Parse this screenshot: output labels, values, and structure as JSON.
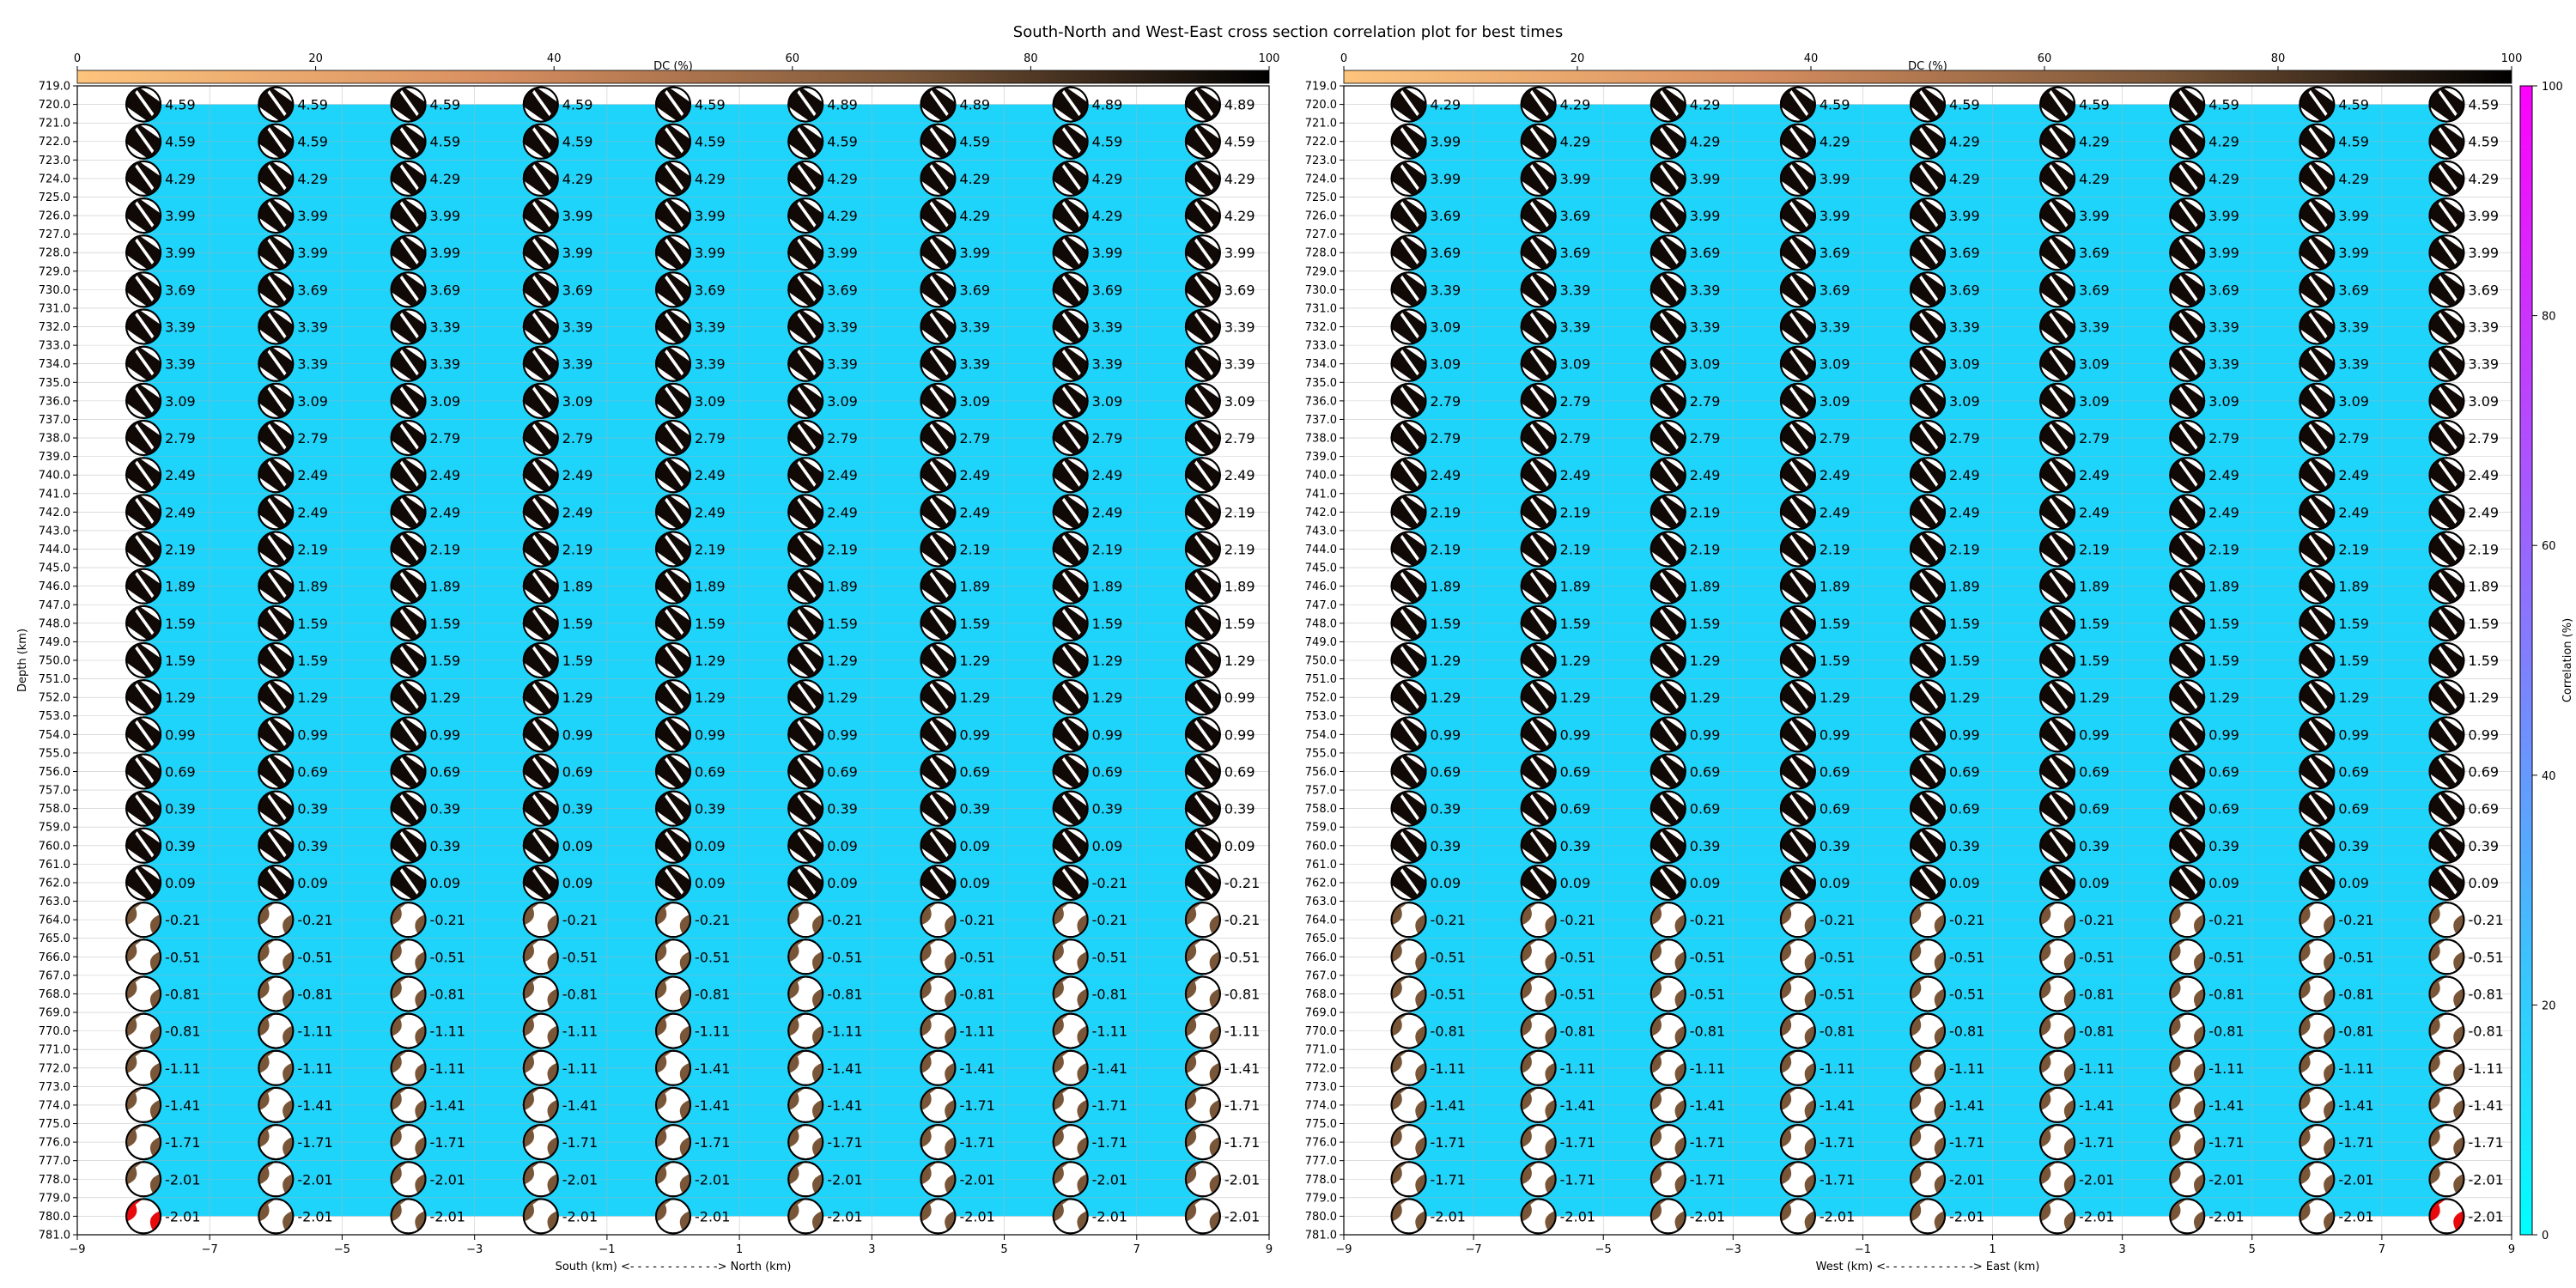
{
  "figure": {
    "title": "South-North and West-East cross section correlation plot for best times",
    "colorbar_correlation_label": "Correlation (%)",
    "colorbar_correlation_ticks": [
      "0",
      "20",
      "40",
      "60",
      "80",
      "100"
    ],
    "colors": {
      "background_correlation": "#1fd4fb",
      "correlation_low": "#00ffff",
      "correlation_high": "#ff00ff",
      "beachball_fill_positive": "#110906",
      "beachball_fill_negative": "#7a5638",
      "best_solution_fill": "#e8090c",
      "grid": "#b0b0b0"
    }
  },
  "chart_data": [
    {
      "type": "scatter",
      "panel": "South-North",
      "xlabel": "South (km) <- - - - - - - - - - - -> North (km)",
      "ylabel": "Depth (km)",
      "xlim": [
        -9,
        9
      ],
      "ylim": [
        781,
        719
      ],
      "x_ticks": [
        "−9",
        "−7",
        "−5",
        "−3",
        "−1",
        "1",
        "3",
        "5",
        "7",
        "9"
      ],
      "top_axis_label": "DC (%)",
      "top_axis_ticks": [
        "0",
        "20",
        "40",
        "60",
        "80",
        "100"
      ],
      "x_positions_km": [
        -8,
        -6,
        -4,
        -2,
        0,
        2,
        4,
        6,
        8
      ],
      "depths_km": [
        720,
        722,
        724,
        726,
        728,
        730,
        732,
        734,
        736,
        738,
        740,
        742,
        744,
        746,
        748,
        750,
        752,
        754,
        756,
        758,
        760,
        762,
        764,
        766,
        768,
        770,
        772,
        774,
        776,
        778,
        780
      ],
      "depth_tick_start": 719,
      "depth_tick_end": 781,
      "correlation_background_percent": 2,
      "best_solution": {
        "x_km": -8,
        "depth_km": 780
      },
      "time_shift_labels": [
        [
          "4.59",
          "4.59",
          "4.59",
          "4.59",
          "4.59",
          "4.89",
          "4.89",
          "4.89",
          "4.89"
        ],
        [
          "4.59",
          "4.59",
          "4.59",
          "4.59",
          "4.59",
          "4.59",
          "4.59",
          "4.59",
          "4.59"
        ],
        [
          "4.29",
          "4.29",
          "4.29",
          "4.29",
          "4.29",
          "4.29",
          "4.29",
          "4.29",
          "4.29"
        ],
        [
          "3.99",
          "3.99",
          "3.99",
          "3.99",
          "3.99",
          "4.29",
          "4.29",
          "4.29",
          "4.29"
        ],
        [
          "3.99",
          "3.99",
          "3.99",
          "3.99",
          "3.99",
          "3.99",
          "3.99",
          "3.99",
          "3.99"
        ],
        [
          "3.69",
          "3.69",
          "3.69",
          "3.69",
          "3.69",
          "3.69",
          "3.69",
          "3.69",
          "3.69"
        ],
        [
          "3.39",
          "3.39",
          "3.39",
          "3.39",
          "3.39",
          "3.39",
          "3.39",
          "3.39",
          "3.39"
        ],
        [
          "3.39",
          "3.39",
          "3.39",
          "3.39",
          "3.39",
          "3.39",
          "3.39",
          "3.39",
          "3.39"
        ],
        [
          "3.09",
          "3.09",
          "3.09",
          "3.09",
          "3.09",
          "3.09",
          "3.09",
          "3.09",
          "3.09"
        ],
        [
          "2.79",
          "2.79",
          "2.79",
          "2.79",
          "2.79",
          "2.79",
          "2.79",
          "2.79",
          "2.79"
        ],
        [
          "2.49",
          "2.49",
          "2.49",
          "2.49",
          "2.49",
          "2.49",
          "2.49",
          "2.49",
          "2.49"
        ],
        [
          "2.49",
          "2.49",
          "2.49",
          "2.49",
          "2.49",
          "2.49",
          "2.49",
          "2.49",
          "2.19"
        ],
        [
          "2.19",
          "2.19",
          "2.19",
          "2.19",
          "2.19",
          "2.19",
          "2.19",
          "2.19",
          "2.19"
        ],
        [
          "1.89",
          "1.89",
          "1.89",
          "1.89",
          "1.89",
          "1.89",
          "1.89",
          "1.89",
          "1.89"
        ],
        [
          "1.59",
          "1.59",
          "1.59",
          "1.59",
          "1.59",
          "1.59",
          "1.59",
          "1.59",
          "1.59"
        ],
        [
          "1.59",
          "1.59",
          "1.59",
          "1.59",
          "1.29",
          "1.29",
          "1.29",
          "1.29",
          "1.29"
        ],
        [
          "1.29",
          "1.29",
          "1.29",
          "1.29",
          "1.29",
          "1.29",
          "1.29",
          "1.29",
          "0.99"
        ],
        [
          "0.99",
          "0.99",
          "0.99",
          "0.99",
          "0.99",
          "0.99",
          "0.99",
          "0.99",
          "0.99"
        ],
        [
          "0.69",
          "0.69",
          "0.69",
          "0.69",
          "0.69",
          "0.69",
          "0.69",
          "0.69",
          "0.69"
        ],
        [
          "0.39",
          "0.39",
          "0.39",
          "0.39",
          "0.39",
          "0.39",
          "0.39",
          "0.39",
          "0.39"
        ],
        [
          "0.39",
          "0.39",
          "0.39",
          "0.09",
          "0.09",
          "0.09",
          "0.09",
          "0.09",
          "0.09"
        ],
        [
          "0.09",
          "0.09",
          "0.09",
          "0.09",
          "0.09",
          "0.09",
          "0.09",
          "-0.21",
          "-0.21"
        ],
        [
          "-0.21",
          "-0.21",
          "-0.21",
          "-0.21",
          "-0.21",
          "-0.21",
          "-0.21",
          "-0.21",
          "-0.21"
        ],
        [
          "-0.51",
          "-0.51",
          "-0.51",
          "-0.51",
          "-0.51",
          "-0.51",
          "-0.51",
          "-0.51",
          "-0.51"
        ],
        [
          "-0.81",
          "-0.81",
          "-0.81",
          "-0.81",
          "-0.81",
          "-0.81",
          "-0.81",
          "-0.81",
          "-0.81"
        ],
        [
          "-0.81",
          "-1.11",
          "-1.11",
          "-1.11",
          "-1.11",
          "-1.11",
          "-1.11",
          "-1.11",
          "-1.11"
        ],
        [
          "-1.11",
          "-1.11",
          "-1.11",
          "-1.11",
          "-1.41",
          "-1.41",
          "-1.41",
          "-1.41",
          "-1.41"
        ],
        [
          "-1.41",
          "-1.41",
          "-1.41",
          "-1.41",
          "-1.41",
          "-1.41",
          "-1.71",
          "-1.71",
          "-1.71"
        ],
        [
          "-1.71",
          "-1.71",
          "-1.71",
          "-1.71",
          "-1.71",
          "-1.71",
          "-1.71",
          "-1.71",
          "-1.71"
        ],
        [
          "-2.01",
          "-2.01",
          "-2.01",
          "-2.01",
          "-2.01",
          "-2.01",
          "-2.01",
          "-2.01",
          "-2.01"
        ],
        [
          "-2.01",
          "-2.01",
          "-2.01",
          "-2.01",
          "-2.01",
          "-2.01",
          "-2.01",
          "-2.01",
          "-2.01"
        ]
      ]
    },
    {
      "type": "scatter",
      "panel": "West-East",
      "xlabel": "West (km) <- - - - - - - - - - - -> East (km)",
      "ylabel": "",
      "xlim": [
        -9,
        9
      ],
      "ylim": [
        781,
        719
      ],
      "x_ticks": [
        "−9",
        "−7",
        "−5",
        "−3",
        "−1",
        "1",
        "3",
        "5",
        "7",
        "9"
      ],
      "top_axis_label": "DC (%)",
      "top_axis_ticks": [
        "0",
        "20",
        "40",
        "60",
        "80",
        "100"
      ],
      "x_positions_km": [
        -8,
        -6,
        -4,
        -2,
        0,
        2,
        4,
        6,
        8
      ],
      "depths_km": [
        720,
        722,
        724,
        726,
        728,
        730,
        732,
        734,
        736,
        738,
        740,
        742,
        744,
        746,
        748,
        750,
        752,
        754,
        756,
        758,
        760,
        762,
        764,
        766,
        768,
        770,
        772,
        774,
        776,
        778,
        780
      ],
      "depth_tick_start": 719,
      "depth_tick_end": 781,
      "correlation_background_percent": 2,
      "best_solution": {
        "x_km": 8,
        "depth_km": 780
      },
      "time_shift_labels": [
        [
          "4.29",
          "4.29",
          "4.29",
          "4.59",
          "4.59",
          "4.59",
          "4.59",
          "4.59",
          "4.59"
        ],
        [
          "3.99",
          "4.29",
          "4.29",
          "4.29",
          "4.29",
          "4.29",
          "4.29",
          "4.59",
          "4.59"
        ],
        [
          "3.99",
          "3.99",
          "3.99",
          "3.99",
          "4.29",
          "4.29",
          "4.29",
          "4.29",
          "4.29"
        ],
        [
          "3.69",
          "3.69",
          "3.99",
          "3.99",
          "3.99",
          "3.99",
          "3.99",
          "3.99",
          "3.99"
        ],
        [
          "3.69",
          "3.69",
          "3.69",
          "3.69",
          "3.69",
          "3.69",
          "3.99",
          "3.99",
          "3.99"
        ],
        [
          "3.39",
          "3.39",
          "3.39",
          "3.69",
          "3.69",
          "3.69",
          "3.69",
          "3.69",
          "3.69"
        ],
        [
          "3.09",
          "3.39",
          "3.39",
          "3.39",
          "3.39",
          "3.39",
          "3.39",
          "3.39",
          "3.39"
        ],
        [
          "3.09",
          "3.09",
          "3.09",
          "3.09",
          "3.09",
          "3.09",
          "3.39",
          "3.39",
          "3.39"
        ],
        [
          "2.79",
          "2.79",
          "2.79",
          "3.09",
          "3.09",
          "3.09",
          "3.09",
          "3.09",
          "3.09"
        ],
        [
          "2.79",
          "2.79",
          "2.79",
          "2.79",
          "2.79",
          "2.79",
          "2.79",
          "2.79",
          "2.79"
        ],
        [
          "2.49",
          "2.49",
          "2.49",
          "2.49",
          "2.49",
          "2.49",
          "2.49",
          "2.49",
          "2.49"
        ],
        [
          "2.19",
          "2.19",
          "2.19",
          "2.49",
          "2.49",
          "2.49",
          "2.49",
          "2.49",
          "2.49"
        ],
        [
          "2.19",
          "2.19",
          "2.19",
          "2.19",
          "2.19",
          "2.19",
          "2.19",
          "2.19",
          "2.19"
        ],
        [
          "1.89",
          "1.89",
          "1.89",
          "1.89",
          "1.89",
          "1.89",
          "1.89",
          "1.89",
          "1.89"
        ],
        [
          "1.59",
          "1.59",
          "1.59",
          "1.59",
          "1.59",
          "1.59",
          "1.59",
          "1.59",
          "1.59"
        ],
        [
          "1.29",
          "1.29",
          "1.29",
          "1.59",
          "1.59",
          "1.59",
          "1.59",
          "1.59",
          "1.59"
        ],
        [
          "1.29",
          "1.29",
          "1.29",
          "1.29",
          "1.29",
          "1.29",
          "1.29",
          "1.29",
          "1.29"
        ],
        [
          "0.99",
          "0.99",
          "0.99",
          "0.99",
          "0.99",
          "0.99",
          "0.99",
          "0.99",
          "0.99"
        ],
        [
          "0.69",
          "0.69",
          "0.69",
          "0.69",
          "0.69",
          "0.69",
          "0.69",
          "0.69",
          "0.69"
        ],
        [
          "0.39",
          "0.69",
          "0.69",
          "0.69",
          "0.69",
          "0.69",
          "0.69",
          "0.69",
          "0.69"
        ],
        [
          "0.39",
          "0.39",
          "0.39",
          "0.39",
          "0.39",
          "0.39",
          "0.39",
          "0.39",
          "0.39"
        ],
        [
          "0.09",
          "0.09",
          "0.09",
          "0.09",
          "0.09",
          "0.09",
          "0.09",
          "0.09",
          "0.09"
        ],
        [
          "-0.21",
          "-0.21",
          "-0.21",
          "-0.21",
          "-0.21",
          "-0.21",
          "-0.21",
          "-0.21",
          "-0.21"
        ],
        [
          "-0.51",
          "-0.51",
          "-0.51",
          "-0.51",
          "-0.51",
          "-0.51",
          "-0.51",
          "-0.51",
          "-0.51"
        ],
        [
          "-0.51",
          "-0.51",
          "-0.51",
          "-0.51",
          "-0.51",
          "-0.81",
          "-0.81",
          "-0.81",
          "-0.81"
        ],
        [
          "-0.81",
          "-0.81",
          "-0.81",
          "-0.81",
          "-0.81",
          "-0.81",
          "-0.81",
          "-0.81",
          "-0.81"
        ],
        [
          "-1.11",
          "-1.11",
          "-1.11",
          "-1.11",
          "-1.11",
          "-1.11",
          "-1.11",
          "-1.11",
          "-1.11"
        ],
        [
          "-1.41",
          "-1.41",
          "-1.41",
          "-1.41",
          "-1.41",
          "-1.41",
          "-1.41",
          "-1.41",
          "-1.41"
        ],
        [
          "-1.71",
          "-1.71",
          "-1.71",
          "-1.71",
          "-1.71",
          "-1.71",
          "-1.71",
          "-1.71",
          "-1.71"
        ],
        [
          "-1.71",
          "-1.71",
          "-1.71",
          "-1.71",
          "-2.01",
          "-2.01",
          "-2.01",
          "-2.01",
          "-2.01"
        ],
        [
          "-2.01",
          "-2.01",
          "-2.01",
          "-2.01",
          "-2.01",
          "-2.01",
          "-2.01",
          "-2.01",
          "-2.01"
        ]
      ]
    }
  ]
}
